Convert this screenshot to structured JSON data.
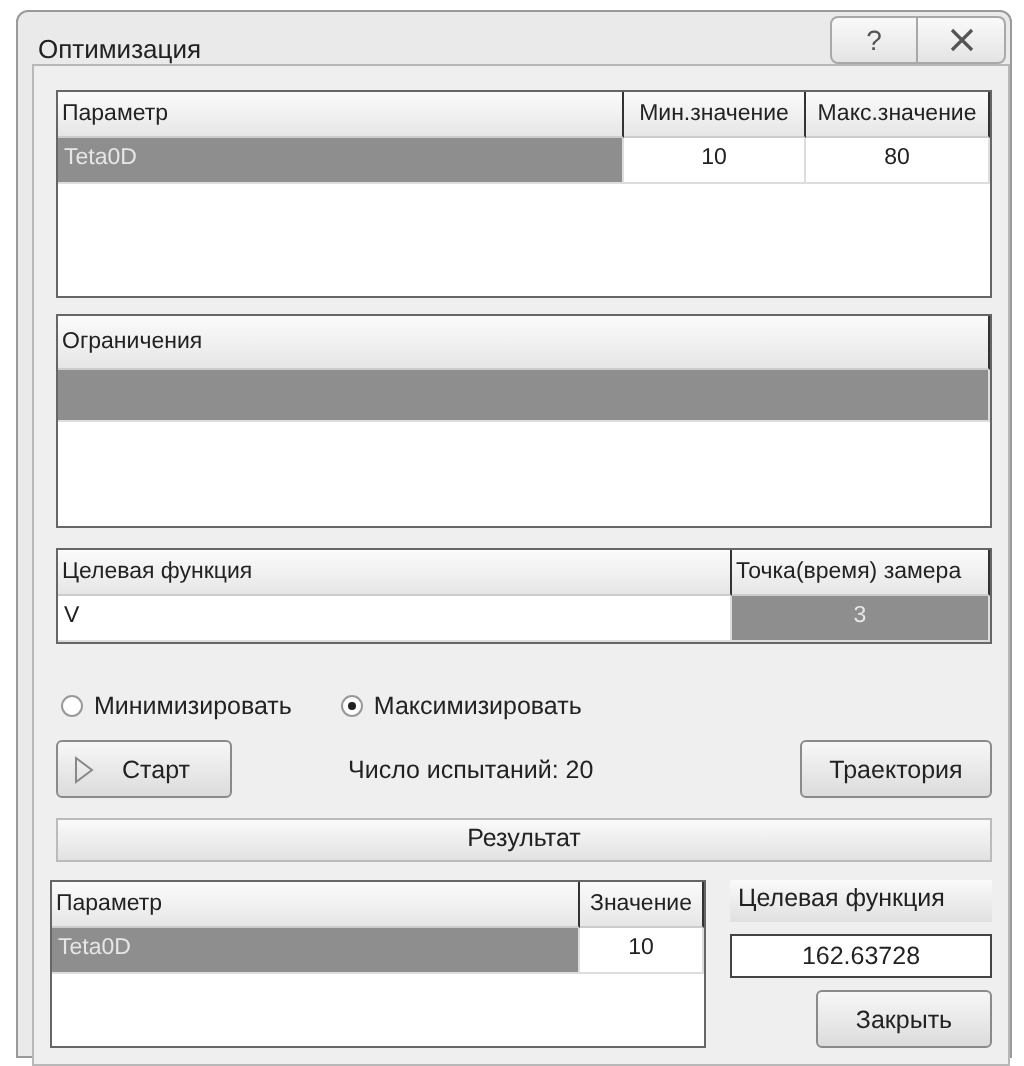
{
  "window": {
    "title": "Оптимизация",
    "help": "?"
  },
  "parameters": {
    "columns": [
      "Параметр",
      "Мин.значение",
      "Макс.значение"
    ],
    "rows": [
      {
        "cells": [
          {
            "text": "Teta0D",
            "selected": true
          },
          {
            "text": "10",
            "selected": false
          },
          {
            "text": "80",
            "selected": false
          }
        ]
      }
    ]
  },
  "constraints": {
    "columns": [
      "Ограничения"
    ],
    "rows": [
      {
        "selected": true
      }
    ]
  },
  "objective": {
    "columns": [
      "Целевая функция",
      "Точка(время) замера"
    ],
    "rows": [
      {
        "cells": [
          {
            "text": "V",
            "selected": false
          },
          {
            "text": "3",
            "selected": true
          }
        ]
      }
    ]
  },
  "mode": [
    {
      "label": "Минимизировать",
      "selected": false
    },
    {
      "label": "Максимизировать",
      "selected": true
    }
  ],
  "start_button": "Старт",
  "trials": "Число испытаний: 20",
  "trajectory_button": "Траектория",
  "result_header": "Результат",
  "result": {
    "columns": [
      "Параметр",
      "Значение"
    ],
    "rows": [
      {
        "cells": [
          {
            "text": "Teta0D",
            "selected": true
          },
          {
            "text": "10",
            "selected": false
          }
        ]
      }
    ]
  },
  "objective_label": "Целевая функция",
  "objective_value": "162.63728",
  "close_button": "Закрыть"
}
